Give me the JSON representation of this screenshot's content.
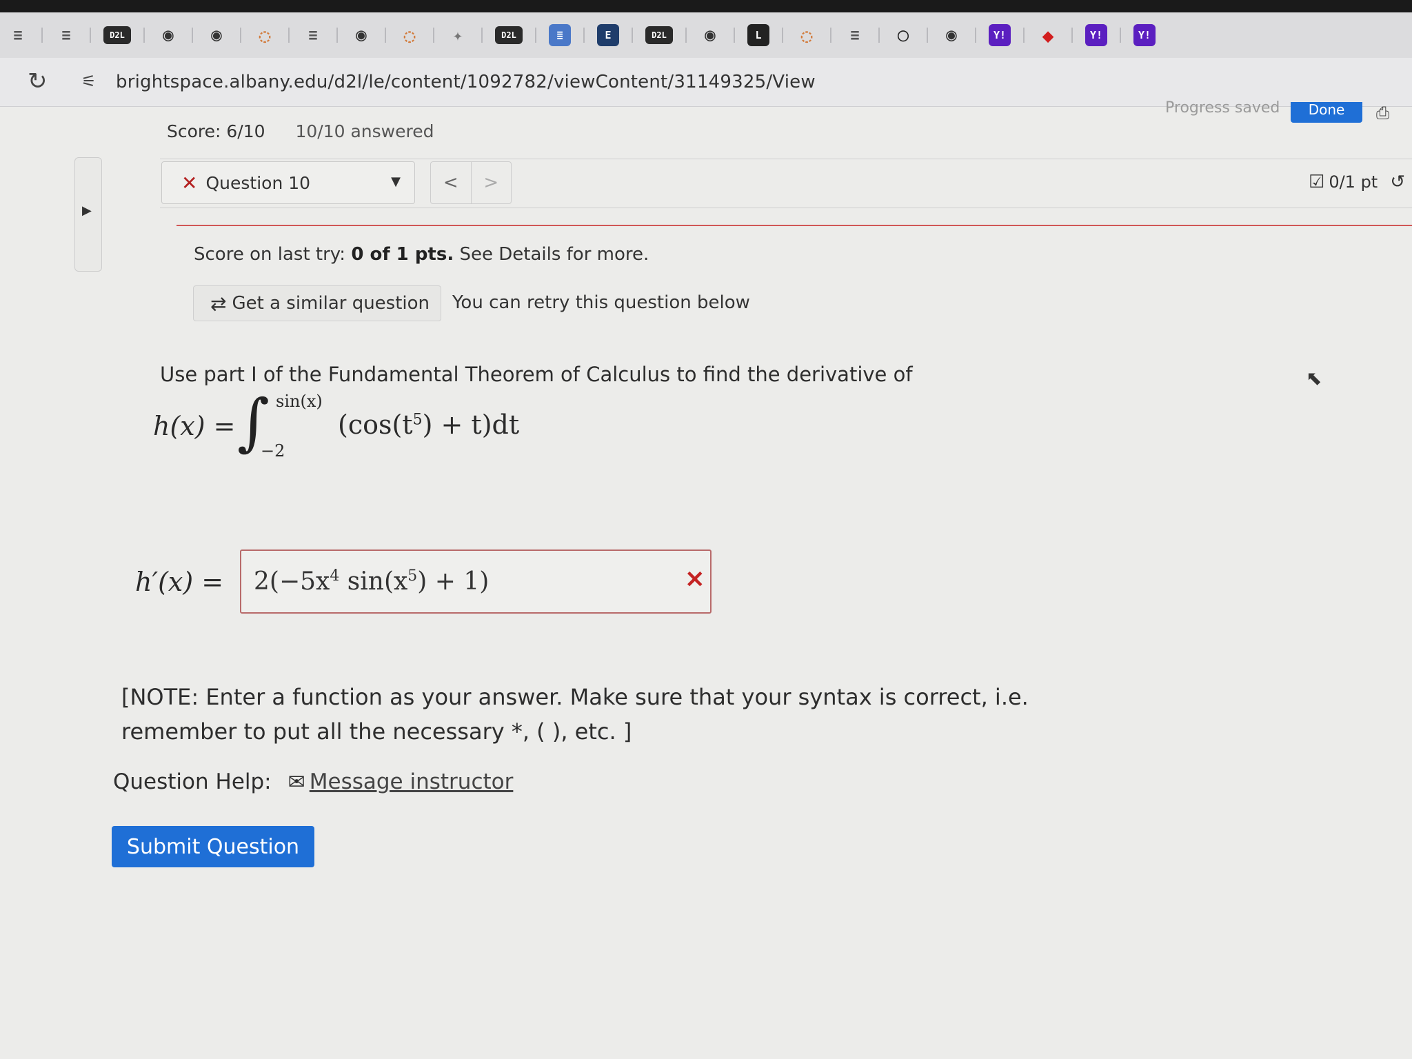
{
  "browser": {
    "bookmarks": [
      {
        "icon": "lines-icon",
        "glyph": "≡"
      },
      {
        "icon": "lines-icon",
        "glyph": "≡"
      },
      {
        "icon": "d2l-icon",
        "glyph": "D2L"
      },
      {
        "icon": "globe-icon",
        "glyph": "◉"
      },
      {
        "icon": "globe-icon",
        "glyph": "◉"
      },
      {
        "icon": "ring-icon",
        "glyph": "◌"
      },
      {
        "icon": "lines-icon",
        "glyph": "≡"
      },
      {
        "icon": "globe-icon",
        "glyph": "◉"
      },
      {
        "icon": "ring-icon",
        "glyph": "◌"
      },
      {
        "icon": "star-icon",
        "glyph": "✦"
      },
      {
        "icon": "d2l-icon",
        "glyph": "D2L"
      },
      {
        "icon": "doc-icon",
        "glyph": "≣"
      },
      {
        "icon": "e-icon",
        "glyph": "E"
      },
      {
        "icon": "d2l-icon",
        "glyph": "D2L"
      },
      {
        "icon": "globe-icon",
        "glyph": "◉"
      },
      {
        "icon": "l-icon",
        "glyph": "L"
      },
      {
        "icon": "ring-icon",
        "glyph": "◌"
      },
      {
        "icon": "lines-icon",
        "glyph": "≡"
      },
      {
        "icon": "github-icon",
        "glyph": "◯"
      },
      {
        "icon": "globe-icon",
        "glyph": "◉"
      },
      {
        "icon": "yahoo-icon",
        "glyph": "Y!"
      },
      {
        "icon": "red-icon",
        "glyph": "◆"
      },
      {
        "icon": "yahoo-icon",
        "glyph": "Y!"
      },
      {
        "icon": "yahoo-icon",
        "glyph": "Y!"
      }
    ],
    "url": "brightspace.albany.edu/d2l/le/content/1092782/viewContent/31149325/View"
  },
  "header": {
    "progress_text": "Progress saved",
    "done_label": "Done",
    "score": "Score: 6/10",
    "answered": "10/10 answered"
  },
  "question_nav": {
    "current": "Question 10",
    "prev": "<",
    "next": ">",
    "points": "0/1 pt"
  },
  "feedback": {
    "last_try_prefix": "Score on last try: ",
    "last_try_score": "0 of 1 pts.",
    "last_try_suffix": " See Details for more.",
    "similar_button": "Get a similar question",
    "retry_text": "You can retry this question below"
  },
  "question": {
    "prompt": "Use part I of the Fundamental Theorem of Calculus to find the derivative of",
    "function_lhs": "h(x) =",
    "upper_limit": "sin(x)",
    "lower_limit": "−2",
    "integrand_a": "(cos(t",
    "integrand_exp": "5",
    "integrand_b": ") + t)dt",
    "answer_lhs": "h′(x) =",
    "answer_a": "2(−5x",
    "answer_exp1": "4",
    "answer_b": " sin(x",
    "answer_exp2": "5",
    "answer_c": ") + 1)",
    "answer_status": "incorrect",
    "note": "[NOTE: Enter a function as your answer. Make sure that your syntax is correct, i.e. remember to put all the necessary *, ( ), etc. ]"
  },
  "help": {
    "label": "Question Help:",
    "message_link": "Message instructor"
  },
  "submit_label": "Submit Question"
}
